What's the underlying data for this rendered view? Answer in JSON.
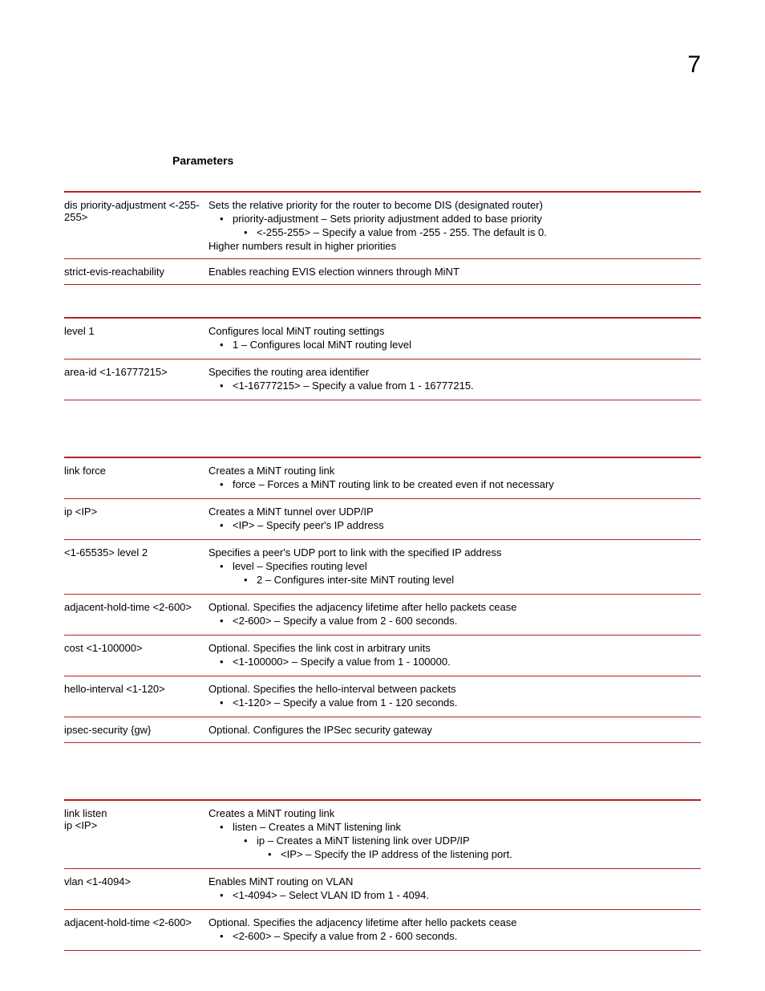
{
  "page_number": "7",
  "section_title": "Parameters",
  "table1": [
    {
      "param": "dis priority-adjustment <-255-255>",
      "desc": "Sets the relative priority for the router to become DIS (designated router)",
      "b1": "priority-adjustment – Sets priority adjustment added to base priority",
      "b2": "<-255-255> – Specify a value from -255 - 255. The default is 0.",
      "trailer": "Higher numbers result in higher priorities"
    },
    {
      "param": "strict-evis-reachability",
      "desc": "Enables reaching EVIS election winners through MiNT"
    }
  ],
  "table2": [
    {
      "param": "level 1",
      "desc": "Configures local MiNT routing settings",
      "b1": "1 – Configures local MiNT routing level"
    },
    {
      "param": "area-id <1-16777215>",
      "desc": "Specifies the routing area identifier",
      "b1": "<1-16777215> – Specify a value from 1 - 16777215."
    }
  ],
  "table3": [
    {
      "param": "link force",
      "desc": "Creates a MiNT routing link",
      "b1": "force – Forces a MiNT routing link to be created even if not necessary"
    },
    {
      "param": "ip <IP>",
      "desc": "Creates a MiNT tunnel over UDP/IP",
      "b1": "<IP> – Specify peer's IP address"
    },
    {
      "param": "<1-65535> level 2",
      "desc": "Specifies a peer's UDP port to link with the specified IP address",
      "b1": "level – Specifies routing level",
      "b2": "2 – Configures inter-site MiNT routing level"
    },
    {
      "param": "adjacent-hold-time <2-600>",
      "desc": "Optional. Specifies the adjacency lifetime after hello packets cease",
      "b1": "<2-600> – Specify a value from 2 - 600 seconds."
    },
    {
      "param": "cost <1-100000>",
      "desc": "Optional. Specifies the link cost in arbitrary units",
      "b1": "<1-100000> – Specify a value from 1 - 100000."
    },
    {
      "param": "hello-interval <1-120>",
      "desc": "Optional. Specifies the hello-interval between packets",
      "b1": "<1-120> – Specify a value from 1 - 120 seconds."
    },
    {
      "param": "ipsec-security {gw}",
      "desc": "Optional. Configures the IPSec security gateway"
    }
  ],
  "table4": [
    {
      "param_l1": "link listen",
      "param_l2": "ip <IP>",
      "desc": "Creates a MiNT routing link",
      "b1": "listen – Creates a MiNT listening link",
      "b2": "ip – Creates a MiNT listening link over UDP/IP",
      "b3": "<IP> – Specify the IP address of the listening port."
    },
    {
      "param": "vlan <1-4094>",
      "desc": "Enables MiNT routing on VLAN",
      "b1": "<1-4094> – Select VLAN ID from 1 - 4094."
    },
    {
      "param": "adjacent-hold-time <2-600>",
      "desc": "Optional. Specifies the adjacency lifetime after hello packets cease",
      "b1": "<2-600> – Specify a value from 2 - 600 seconds."
    }
  ]
}
